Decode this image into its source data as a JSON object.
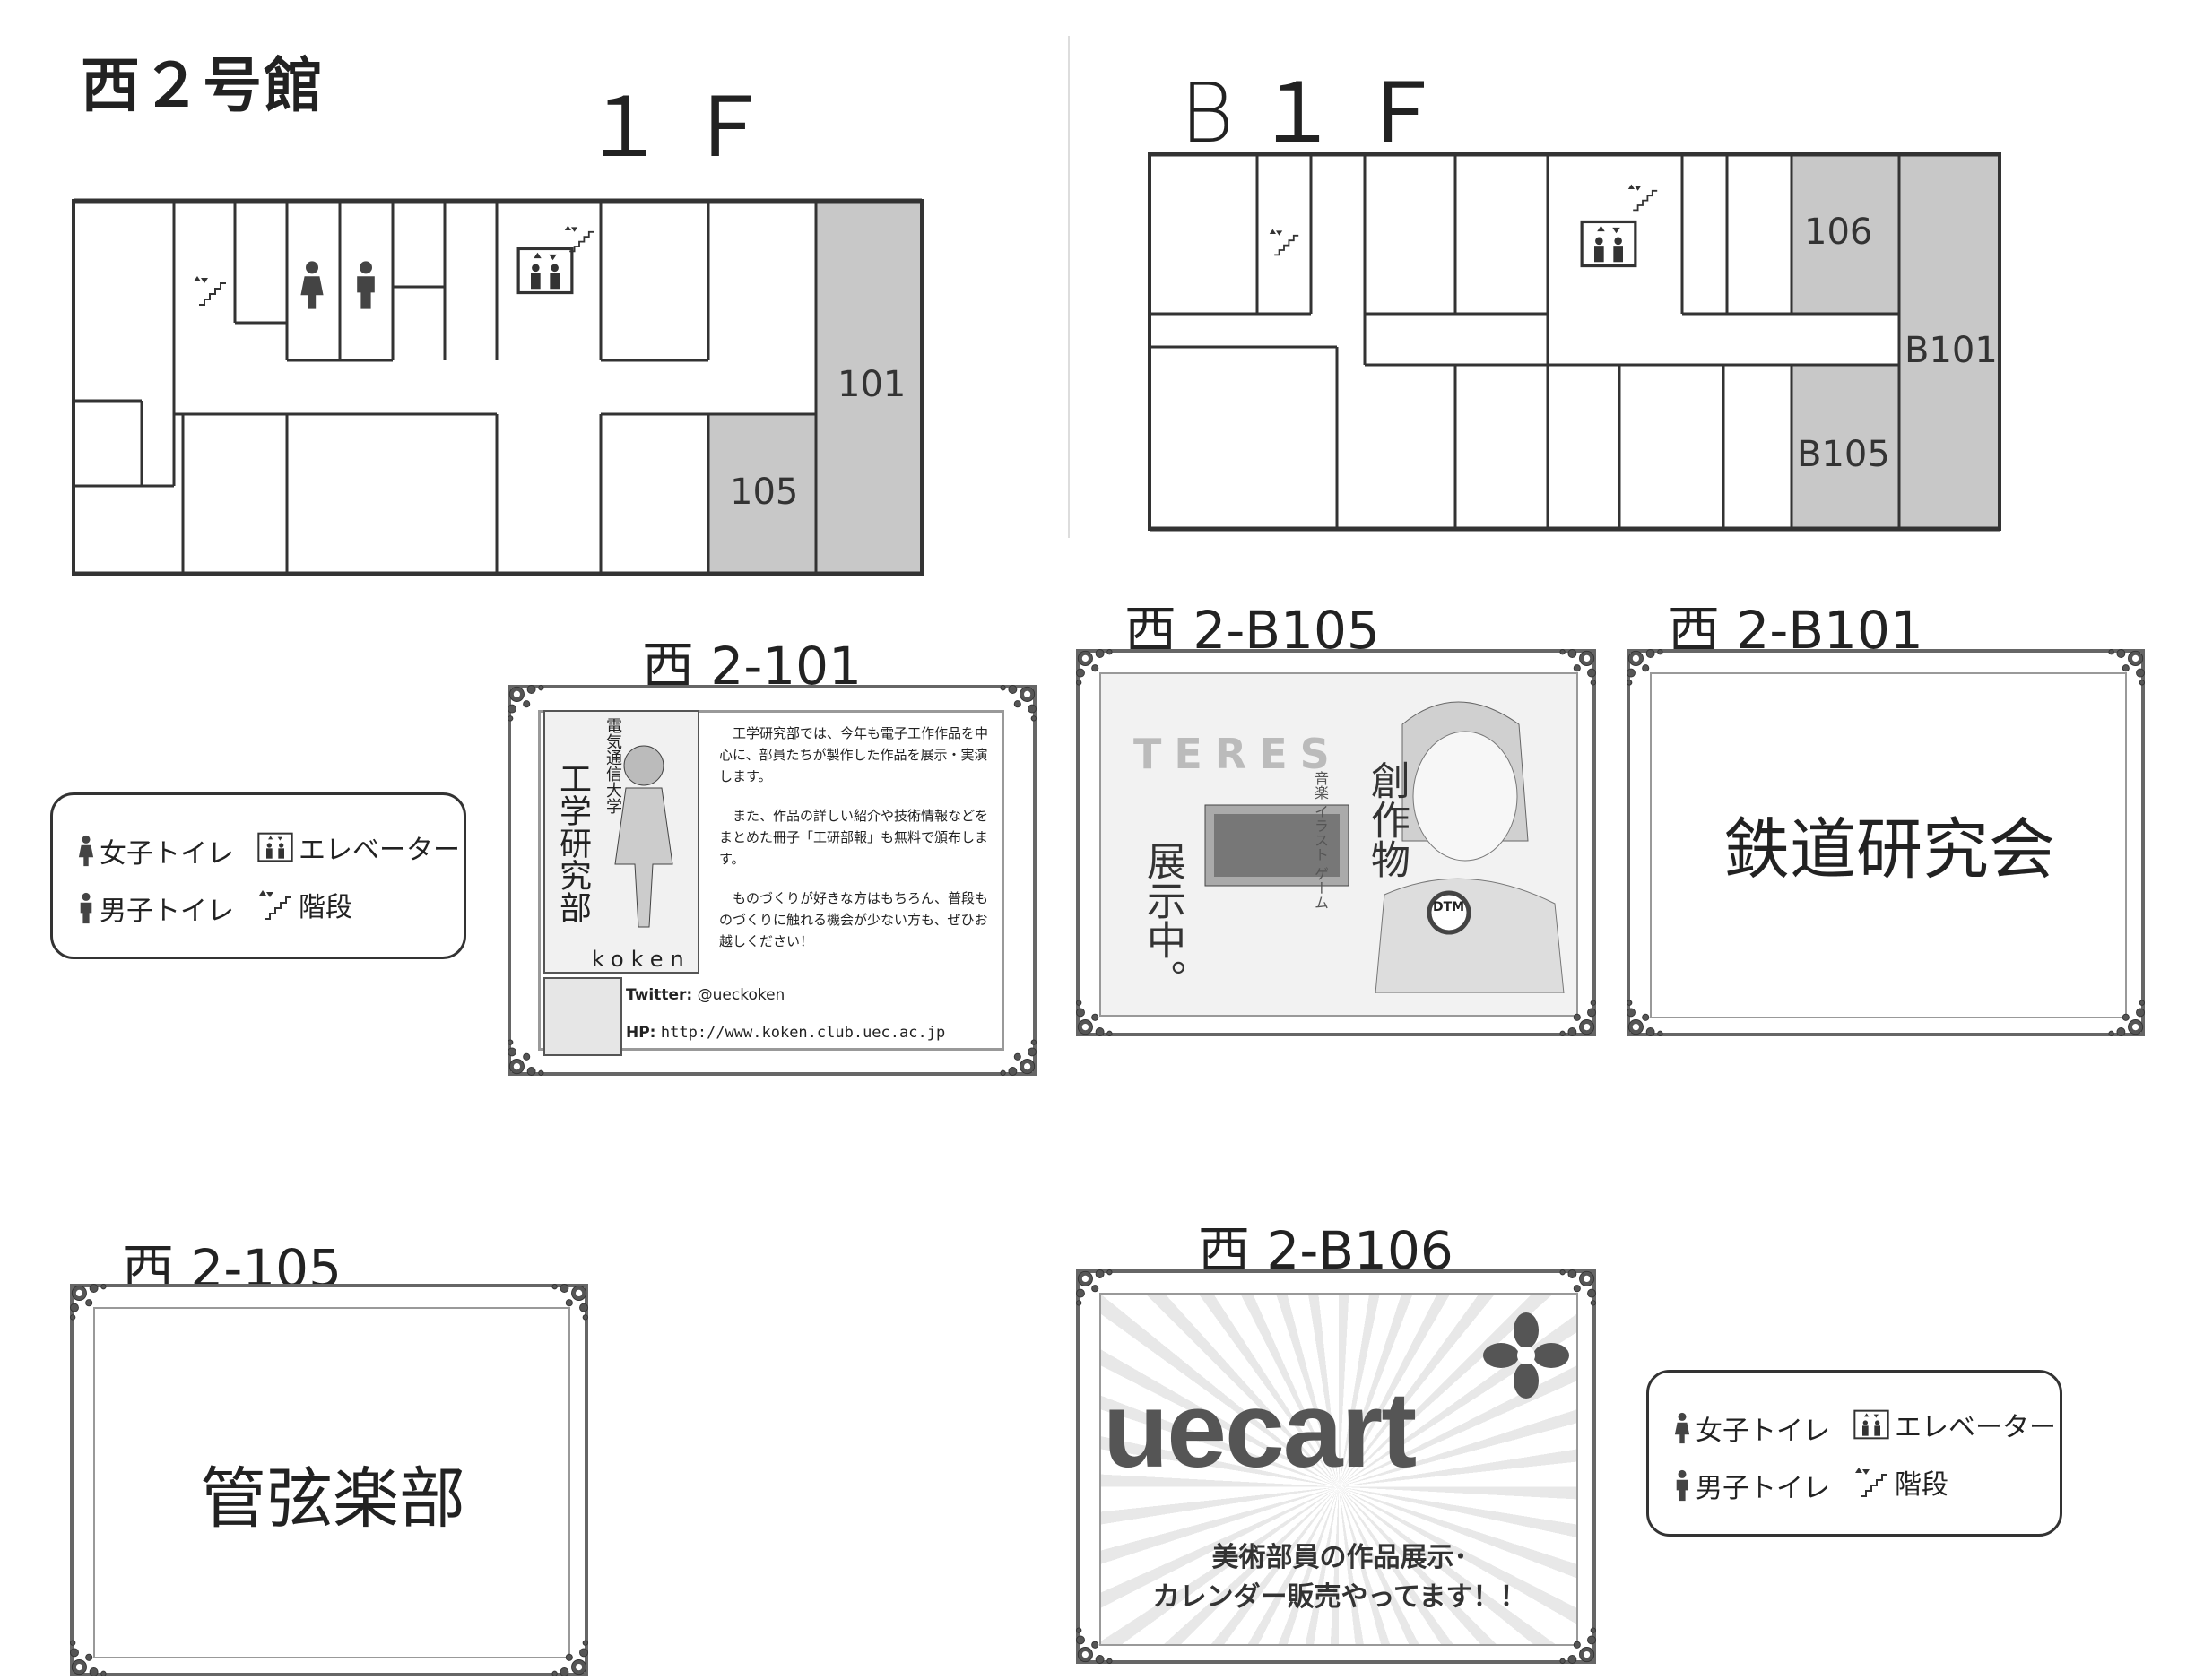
{
  "building": {
    "title": "西２号館"
  },
  "floors": {
    "f1": {
      "label": "１Ｆ",
      "rooms": {
        "r101": "101",
        "r105": "105"
      }
    },
    "b1": {
      "label": "B１Ｆ",
      "rooms": {
        "r106": "106",
        "rb101": "B101",
        "rb105": "B105"
      }
    }
  },
  "legend": {
    "women": "女子トイレ",
    "men": "男子トイレ",
    "elevator": "エレベーター",
    "stairs": "階段"
  },
  "cards": {
    "c101": {
      "title": "西 2-101",
      "vertical_small": "電気通信大学",
      "vertical_big": "工学研究部",
      "koken": "koken",
      "paragraphs": [
        "工学研究部では、今年も電子工作作品を中心に、部員たちが製作した作品を展示・実演します。",
        "また、作品の詳しい紹介や技術情報などをまとめた冊子「工研部報」も無料で頒布します。",
        "ものづくりが好きな方はもちろん、普段ものづくりに触れる機会が少ない方も、ぜひお越しください！"
      ],
      "twitter_label": "Twitter:",
      "twitter": "@ueckoken",
      "hp_label": "HP:",
      "hp": "http://www.koken.club.uec.ac.jp"
    },
    "cb105": {
      "title": "西 2-B105",
      "logo": "TERES",
      "subtitle": "音楽 イラスト ゲーム",
      "work": "創作物",
      "exhibit": "展示中。",
      "dtm": "DTM"
    },
    "cb101": {
      "title": "西 2-B101",
      "name": "鉄道研究会"
    },
    "c105": {
      "title": "西 2-105",
      "name": "管弦楽部"
    },
    "cb106": {
      "title": "西 2-B106",
      "logo": "uecart",
      "line1": "美術部員の作品展示･",
      "line2": "カレンダー販売やってます！！"
    }
  },
  "colors": {
    "room_highlight": "#c8c8c8",
    "line": "#333333"
  }
}
